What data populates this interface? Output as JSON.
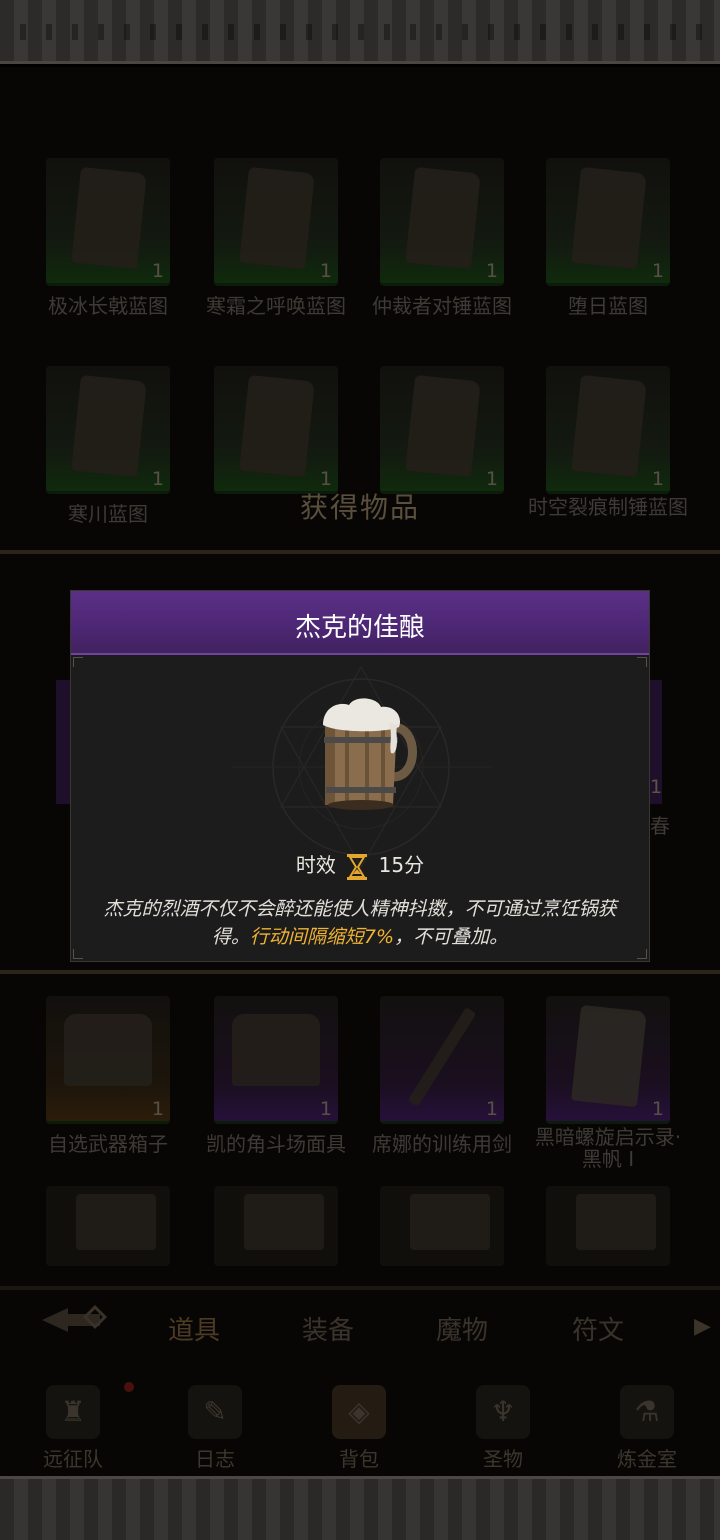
{
  "inventory": {
    "rows": [
      [
        {
          "name": "极冰长戟蓝图",
          "qty": "1",
          "rarity": "green"
        },
        {
          "name": "寒霜之呼唤蓝图",
          "qty": "1",
          "rarity": "green"
        },
        {
          "name": "仲裁者对锤蓝图",
          "qty": "1",
          "rarity": "green"
        },
        {
          "name": "堕日蓝图",
          "qty": "1",
          "rarity": "green"
        }
      ],
      [
        {
          "name": "寒川蓝图",
          "qty": "1",
          "rarity": "green"
        },
        {
          "name": "",
          "qty": "1",
          "rarity": "green"
        },
        {
          "name": "",
          "qty": "1",
          "rarity": "green"
        },
        {
          "name": "时空裂痕制锤蓝图",
          "qty": "1",
          "rarity": "green"
        }
      ],
      [
        {
          "name": "自选武器箱子",
          "qty": "1",
          "rarity": "orange"
        },
        {
          "name": "凯的角斗场面具",
          "qty": "1",
          "rarity": "purple"
        },
        {
          "name": "席娜的训练用剑",
          "qty": "1",
          "rarity": "purple"
        },
        {
          "name": "黑暗螺旋启示录·黑帆 I",
          "qty": "1",
          "rarity": "purple"
        }
      ]
    ],
    "partial_right_label": "春",
    "partial_right_qty": "1"
  },
  "obtained_banner": {
    "title": "获得物品"
  },
  "tabs": {
    "items": [
      "道具",
      "装备",
      "魔物",
      "符文"
    ],
    "active_index": 0
  },
  "bottom_nav": {
    "items": [
      {
        "label": "远征队",
        "icon": "helmet-icon"
      },
      {
        "label": "日志",
        "icon": "book-icon"
      },
      {
        "label": "背包",
        "icon": "backpack-icon"
      },
      {
        "label": "圣物",
        "icon": "relic-icon"
      },
      {
        "label": "炼金室",
        "icon": "alchemy-icon"
      }
    ],
    "active_index": 2
  },
  "modal": {
    "title": "杰克的佳酿",
    "item_icon": "beer-mug-icon",
    "timer_label": "时效",
    "timer_value": "15分",
    "desc_part1": "杰克的烈酒不仅不会醉还能使人精神抖擞，不可通过烹饪锅获得。",
    "desc_highlight": "行动间隔缩短7%",
    "desc_part2": "，不可叠加。"
  },
  "colors": {
    "header_purple": "#5b2f86",
    "highlight_gold": "#f0b432",
    "rarity_green": "#0f2a0c",
    "rarity_purple": "#27103a",
    "rarity_orange": "#2c1d0a"
  }
}
